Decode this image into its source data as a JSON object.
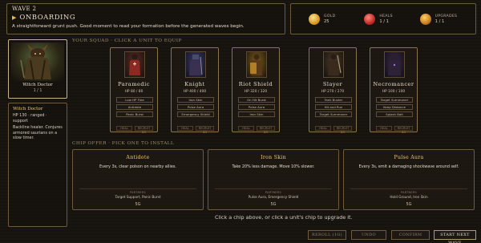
{
  "header": {
    "wave": "WAVE 2",
    "stage": "ONBOARDING",
    "description": "A straightforward grunt push. Good moment to read your formation before the generated waves begin."
  },
  "stats": [
    {
      "label": "GOLD",
      "value": "25",
      "icon": "gold-coin-icon"
    },
    {
      "label": "HEALS",
      "value": "1 / 1",
      "icon": "heart-icon"
    },
    {
      "label": "UPGRADES",
      "value": "1 / 1",
      "icon": "upgrade-icon"
    }
  ],
  "selected": {
    "name": "Witch Doctor",
    "level": "1 / 1",
    "info_name": "Witch Doctor",
    "info_stats": "HP 130 · ranged · support",
    "info_desc": "Backline healer. Conjures armored saurians on a slow timer."
  },
  "squad_heading": "YOUR SQUAD · CLICK A UNIT TO EQUIP",
  "units": [
    {
      "name": "Paramedic",
      "hp": "HP 80 / 80",
      "chips": [
        "Low HP Flee",
        "Antidote",
        "Panic Burst"
      ],
      "heal": "HEAL",
      "recruit": "RECRUIT 8G",
      "color": "#b03a2a"
    },
    {
      "name": "Knight",
      "hp": "HP 400 / 400",
      "chips": [
        "Iron Skin",
        "Pulse Aura",
        "Emergency Shield"
      ],
      "heal": "HEAL",
      "recruit": "RECRUIT 8G",
      "color": "#5a4a8a"
    },
    {
      "name": "Riot Shield",
      "hp": "HP 320 / 320",
      "chips": [
        "On Hit Burst",
        "Pulse Aura",
        "Iron Skin"
      ],
      "heal": "HEAL",
      "recruit": "RECRUIT 8G",
      "color": "#c8902a"
    },
    {
      "name": "Slayer",
      "hp": "HP 270 / 270",
      "chips": [
        "Tank Buster",
        "Hit and Run",
        "Target Summoner"
      ],
      "heal": "HEAL",
      "recruit": "RECRUIT 8G",
      "color": "#7a5a3a"
    },
    {
      "name": "Necromancer",
      "hp": "HP 100 / 100",
      "chips": [
        "Target Summoner",
        "Keep Distance",
        "Splash Bolt"
      ],
      "heal": "HEAL",
      "recruit": "RECRUIT 8G",
      "color": "#4a3a6a"
    }
  ],
  "offer_heading": "CHIP OFFER · PICK ONE TO INSTALL",
  "offers": [
    {
      "title": "Antidote",
      "desc": "Every 3s, clear poison on nearby allies.",
      "partners_label": "PARTNERS",
      "partners": "Target Support, Panic Burst",
      "cost": "5G"
    },
    {
      "title": "Iron Skin",
      "desc": "Take 20% less damage. Move 10% slower.",
      "partners_label": "PARTNERS",
      "partners": "Pulse Aura, Emergency Shield",
      "cost": "5G"
    },
    {
      "title": "Pulse Aura",
      "desc": "Every 3s, emit a damaging shockwave around self.",
      "partners_label": "PARTNERS",
      "partners": "Hold Ground, Iron Skin",
      "cost": "5G"
    }
  ],
  "hint": "Click a chip above, or click a unit's chip to upgrade it.",
  "buttons": {
    "reroll": "REROLL (1G)",
    "undo": "UNDO",
    "confirm": "CONFIRM",
    "next": "START NEXT WAVE"
  }
}
